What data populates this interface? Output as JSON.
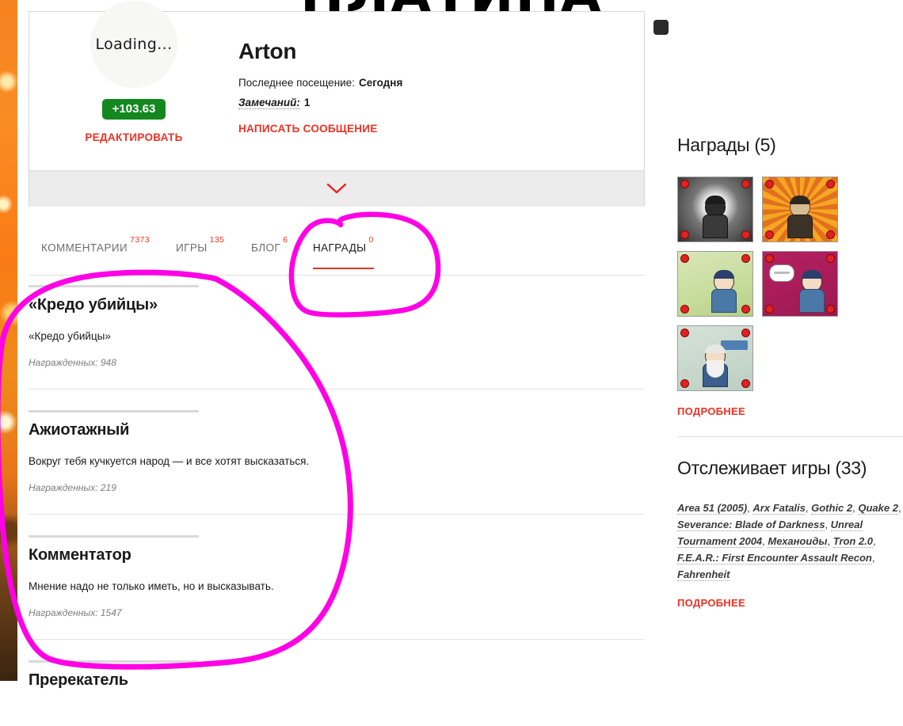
{
  "page": {
    "headline_partial": "ПЛАТИНА",
    "background_strip": "#f58220"
  },
  "profile": {
    "avatar_text": "Loading...",
    "rating_badge": "+103.63",
    "rating_badge_color": "#13881f",
    "edit_label": "РЕДАКТИРОВАТЬ",
    "nickname": "Arton",
    "last_visit_label": "Последнее посещение:",
    "last_visit_value": "Сегодня",
    "warnings_label": "Замечаний:",
    "warnings_value": "1",
    "message_label": "НАПИСАТЬ СООБЩЕНИЕ",
    "expander_icon": "chevron-down-icon",
    "accent_color": "#ee3124"
  },
  "tabs": [
    {
      "label": "КОММЕНТАРИИ",
      "count": "7373",
      "active": false
    },
    {
      "label": "ИГРЫ",
      "count": "135",
      "active": false
    },
    {
      "label": "БЛОГ",
      "count": "6",
      "active": false
    },
    {
      "label": "НАГРАДЫ",
      "count": "0",
      "active": true
    }
  ],
  "awards": [
    {
      "title": "«Кредо убийцы»",
      "description": "«Кредо убийцы»",
      "count_label": "Награжденных: 948"
    },
    {
      "title": "Ажиотажный",
      "description": "Вокруг тебя кучкуется народ — и все хотят высказаться.",
      "count_label": "Награжденных: 219"
    },
    {
      "title": "Комментатор",
      "description": "Мнение надо не только иметь, но и высказывать.",
      "count_label": "Награжденных: 1547"
    },
    {
      "title": "Пререкатель",
      "description": "",
      "count_label": ""
    }
  ],
  "sidebar": {
    "awards_panel": {
      "title": "Награды (5)",
      "badges": [
        {
          "name": "badge-kredo-ubiycy"
        },
        {
          "name": "badge-azhiotazhnyy"
        },
        {
          "name": "badge-kommentator"
        },
        {
          "name": "badge-prerekatel"
        },
        {
          "name": "badge-reyting"
        }
      ],
      "more_label": "ПОДРОБНЕЕ"
    },
    "tracked_panel": {
      "title": "Отслеживает игры (33)",
      "games": [
        "Area 51 (2005)",
        "Arx Fatalis",
        "Gothic 2",
        "Quake 2",
        "Severance: Blade of Darkness",
        "Unreal Tournament 2004",
        "Механоиды",
        "Tron 2.0",
        "F.E.A.R.: First Encounter Assault Recon",
        "Fahrenheit"
      ],
      "more_label": "ПОДРОБНЕЕ"
    }
  },
  "annotations": {
    "color": "#ff00e6",
    "shapes": [
      "circle-around-nagrady-tab",
      "circle-around-awards-list"
    ]
  }
}
